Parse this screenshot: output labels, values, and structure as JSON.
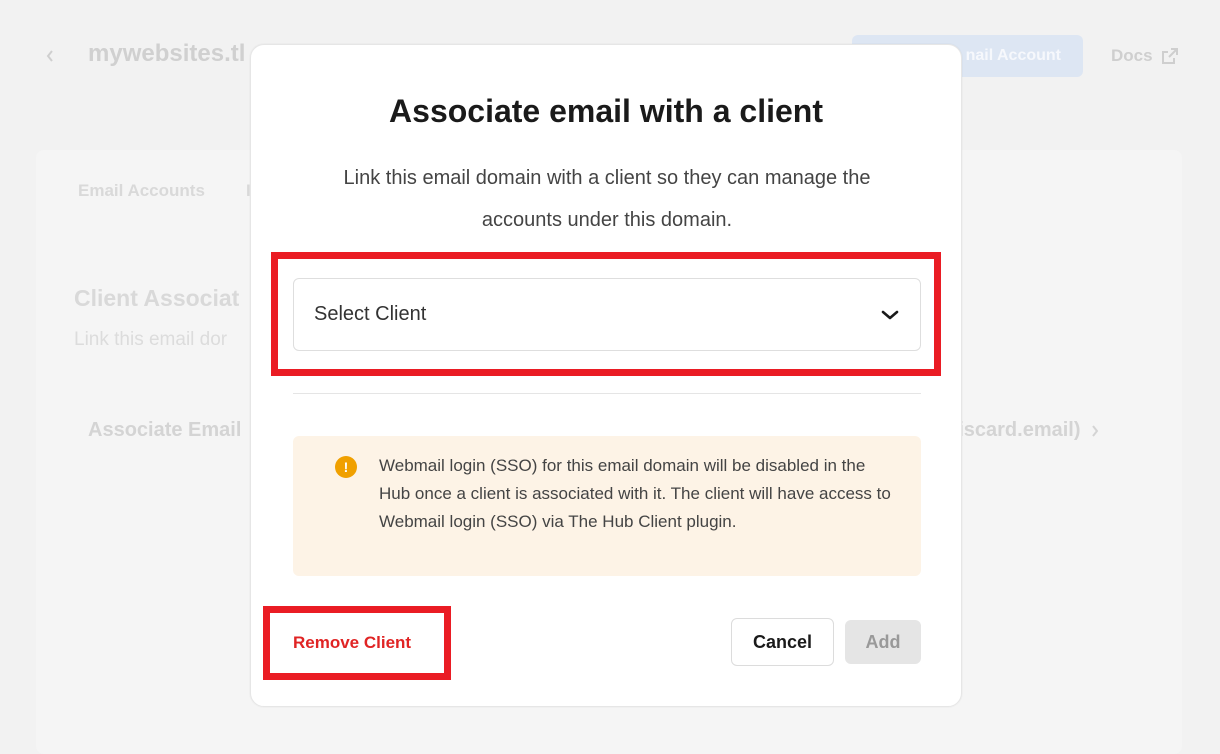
{
  "background": {
    "site_title": "mywebsites.tl",
    "primary_button_label": "nail Account",
    "docs_label": "Docs",
    "tabs": [
      "Email Accounts",
      "I"
    ],
    "section_title": "Client Associat",
    "section_desc": "Link this email dor",
    "row_label": "Associate Email",
    "row_value": "discard.email)"
  },
  "modal": {
    "title": "Associate email with a client",
    "description": "Link this email domain with a client so they can manage the accounts under this domain.",
    "select": {
      "label": "Select Client",
      "icon": "chevron-down-icon"
    },
    "notice": {
      "icon": "warning-icon",
      "text": "Webmail login (SSO) for this email domain will be disabled in the Hub once a client is associated with it. The client will have access to Webmail login (SSO) via The Hub Client plugin."
    },
    "remove_label": "Remove Client",
    "cancel_label": "Cancel",
    "add_label": "Add"
  },
  "colors": {
    "highlight": "#ea1c24",
    "danger_text": "#e02424",
    "notice_bg": "#fdf3e6",
    "notice_icon": "#f0a000"
  }
}
